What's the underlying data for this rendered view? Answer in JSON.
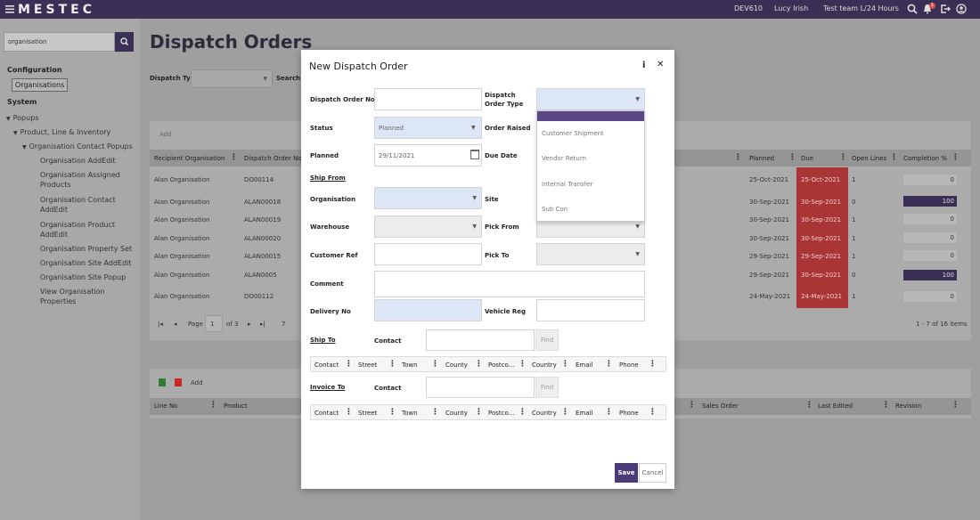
{
  "app": {
    "logo": "MESTEC",
    "topbar_items": [
      "DEV610",
      "Lucy Irish",
      "Test team L/24 Hours"
    ],
    "notification_count": "1"
  },
  "sidebar": {
    "search_value": "organisation",
    "configuration_head": "Configuration",
    "organisations_pill": "Organisations",
    "system_head": "System",
    "popups": "Popups",
    "product_line": "Product, Line & Inventory",
    "org_contact_popups": "Organisation Contact Popups",
    "items": [
      "Organisation AddEdit",
      "Organisation Assigned Products",
      "Organisation Contact AddEdit",
      "Organisation Product AddEdit",
      "Organisation Property Set",
      "Organisation Site AddEdit",
      "Organisation Site Popup",
      "View Organisation Properties"
    ]
  },
  "main": {
    "title": "Dispatch Orders",
    "filter_dispatch_type": "Dispatch Type",
    "filter_search": "Search",
    "add_label": "Add",
    "columns": [
      "Recipient Organisation",
      "Dispatch Order No",
      "Planned",
      "Due",
      "Open Lines",
      "Completion %"
    ],
    "rows": [
      {
        "org": "Alan Organisation",
        "no": "DO00114",
        "planned": "25-Oct-2021",
        "due": "25-Oct-2021",
        "open": "1",
        "completion": "0"
      },
      {
        "org": "Alan Organisation",
        "no": "ALAN00018",
        "planned": "30-Sep-2021",
        "due": "30-Sep-2021",
        "open": "0",
        "completion": "100"
      },
      {
        "org": "Alan Organisation",
        "no": "ALAN00019",
        "planned": "30-Sep-2021",
        "due": "30-Sep-2021",
        "open": "1",
        "completion": "0"
      },
      {
        "org": "Alan Organisation",
        "no": "ALAN00020",
        "planned": "30-Sep-2021",
        "due": "30-Sep-2021",
        "open": "1",
        "completion": "0"
      },
      {
        "org": "Alan Organisation",
        "no": "ALAN00015",
        "planned": "29-Sep-2021",
        "due": "29-Sep-2021",
        "open": "1",
        "completion": "0"
      },
      {
        "org": "Alan Organisation",
        "no": "ALAN0005",
        "planned": "29-Sep-2021",
        "due": "30-Sep-2021",
        "open": "0",
        "completion": "100"
      },
      {
        "org": "Alan Organisation",
        "no": "DO00112",
        "planned": "24-May-2021",
        "due": "24-May-2021",
        "open": "1",
        "completion": "0"
      }
    ],
    "pager": {
      "page_label": "Page",
      "page_value": "1",
      "of": "of 3",
      "size": "7",
      "items": "1 - 7 of 16 items"
    },
    "lower_add": "Add",
    "lower_columns": [
      "Line No",
      "Product",
      "Sales Order",
      "Last Edited",
      "Revision"
    ]
  },
  "modal": {
    "title": "New Dispatch Order",
    "dispatch_order_no": "Dispatch Order No",
    "dispatch_order_type": "Dispatch Order Type",
    "status": "Status",
    "status_value": "Planned",
    "order_raised": "Order Raised",
    "planned": "Planned",
    "planned_value": "29/11/2021",
    "due_date": "Due Date",
    "ship_from": "Ship From",
    "organisation": "Organisation",
    "site": "Site",
    "warehouse": "Warehouse",
    "pick_from": "Pick From",
    "customer_ref": "Customer Ref",
    "pick_to": "Pick To",
    "comment": "Comment",
    "delivery_no": "Delivery No",
    "vehicle_reg": "Vehicle Reg",
    "ship_to": "Ship To",
    "invoice_to": "Invoice To",
    "contact": "Contact",
    "find": "Find",
    "sub_columns": [
      "Contact",
      "Street",
      "Town",
      "County",
      "Postco...",
      "Country",
      "Email",
      "Phone"
    ],
    "save": "Save",
    "cancel": "Cancel",
    "dropdown_options": [
      "Customer Shipment",
      "Vendor Return",
      "Internal Transfer",
      "Sub Con"
    ]
  }
}
